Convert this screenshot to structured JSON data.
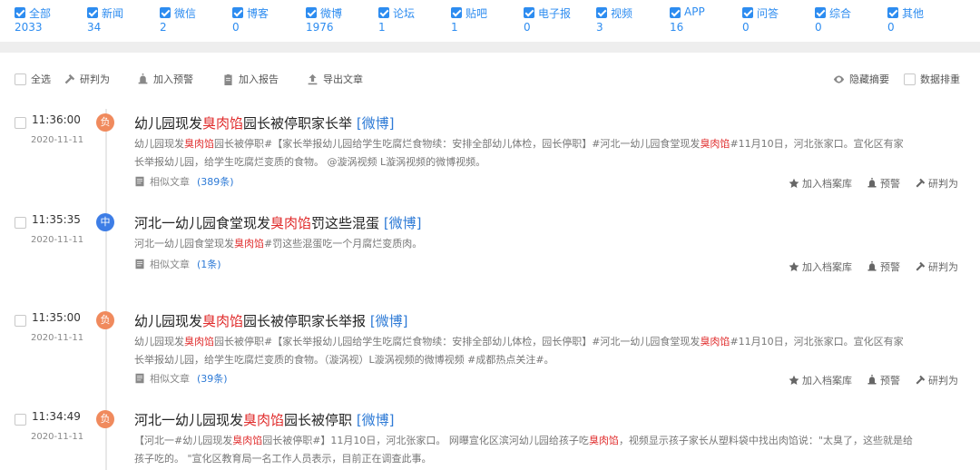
{
  "colors": {
    "accent": "#2d8cf0",
    "keyword": "#e02d2d",
    "negative_badge": "#f08a5d",
    "neutral_badge": "#3d7de6"
  },
  "filters": [
    {
      "label": "全部",
      "count": "2033"
    },
    {
      "label": "新闻",
      "count": "34"
    },
    {
      "label": "微信",
      "count": "2"
    },
    {
      "label": "博客",
      "count": "0"
    },
    {
      "label": "微博",
      "count": "1976"
    },
    {
      "label": "论坛",
      "count": "1"
    },
    {
      "label": "贴吧",
      "count": "1"
    },
    {
      "label": "电子报",
      "count": "0"
    },
    {
      "label": "视频",
      "count": "3"
    },
    {
      "label": "APP",
      "count": "16"
    },
    {
      "label": "问答",
      "count": "0"
    },
    {
      "label": "综合",
      "count": "0"
    },
    {
      "label": "其他",
      "count": "0"
    }
  ],
  "toolbar": {
    "select_all": "全选",
    "judge": "研判为",
    "add_alert": "加入预警",
    "add_report": "加入报告",
    "export": "导出文章",
    "hide_summary": "隐藏摘要",
    "data_dedup": "数据排重"
  },
  "actions": {
    "add_archive": "加入档案库",
    "alert": "预警",
    "judge": "研判为",
    "similar": "相似文章"
  },
  "articles": [
    {
      "time": "11:36:00",
      "date": "2020-11-11",
      "badge": "负",
      "title_pre": "幼儿园现发",
      "title_kw": "臭肉馅",
      "title_post": "园长被停职家长举",
      "source": "[微博]",
      "summary_lines": [
        [
          "幼儿园现发",
          "臭肉馅",
          "园长被停职#【家长举报幼儿园给学生吃腐烂食物续：安排全部幼儿体检，园长停职】#河北一幼儿园食堂现发",
          "臭肉馅",
          "#11月10日，河北张家口。宣化区有家"
        ],
        [
          "长举报幼儿园，给学生吃腐烂变质的食物。 @漩涡视频 L漩涡视频的微博视频。"
        ]
      ],
      "similar_count": "(389条)"
    },
    {
      "time": "11:35:35",
      "date": "2020-11-11",
      "badge": "中",
      "title_pre": "河北一幼儿园食堂现发",
      "title_kw": "臭肉馅",
      "title_post": "罚这些混蛋",
      "source": "[微博]",
      "summary_lines": [
        [
          "河北一幼儿园食堂现发",
          "臭肉馅",
          "#罚这些混蛋吃一个月腐烂变质肉。"
        ]
      ],
      "similar_count": "(1条)"
    },
    {
      "time": "11:35:00",
      "date": "2020-11-11",
      "badge": "负",
      "title_pre": "幼儿园现发",
      "title_kw": "臭肉馅",
      "title_post": "园长被停职家长举报",
      "source": "[微博]",
      "summary_lines": [
        [
          "幼儿园现发",
          "臭肉馅",
          "园长被停职#【家长举报幼儿园给学生吃腐烂食物续：安排全部幼儿体检，园长停职】#河北一幼儿园食堂现发",
          "臭肉馅",
          "#11月10日，河北张家口。宣化区有家"
        ],
        [
          "长举报幼儿园，给学生吃腐烂变质的食物。（漩涡视）L漩涡视频的微博视频 #成都热点关注#。"
        ]
      ],
      "similar_count": "(39条)"
    },
    {
      "time": "11:34:49",
      "date": "2020-11-11",
      "badge": "负",
      "title_pre": "河北一幼儿园现发",
      "title_kw": "臭肉馅",
      "title_post": "园长被停职",
      "source": "[微博]",
      "summary_lines": [
        [
          "【河北一#幼儿园现发",
          "臭肉馅",
          "园长被停职#】11月10日，河北张家口。 网曝宣化区滨河幼儿园给孩子吃",
          "臭肉馅",
          "，视频显示孩子家长从塑料袋中找出肉馅说：\"太臭了，这些就是给"
        ],
        [
          "孩子吃的。 \"宣化区教育局一名工作人员表示，目前正在调查此事。"
        ]
      ],
      "similar_count": ""
    }
  ]
}
